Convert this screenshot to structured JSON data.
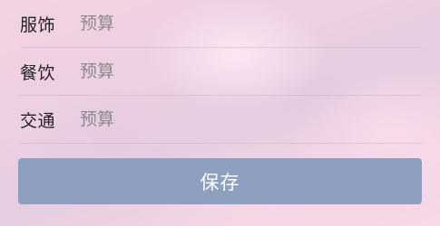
{
  "form": {
    "rows": [
      {
        "label": "服饰",
        "placeholder": "预算",
        "value": ""
      },
      {
        "label": "餐饮",
        "placeholder": "预算",
        "value": ""
      },
      {
        "label": "交通",
        "placeholder": "预算",
        "value": ""
      }
    ]
  },
  "actions": {
    "save_label": "保存"
  },
  "colors": {
    "button_bg": "#8f9fbf",
    "button_text": "#ffffff",
    "label_text": "#222222",
    "placeholder_text": "#8a8a8a"
  }
}
